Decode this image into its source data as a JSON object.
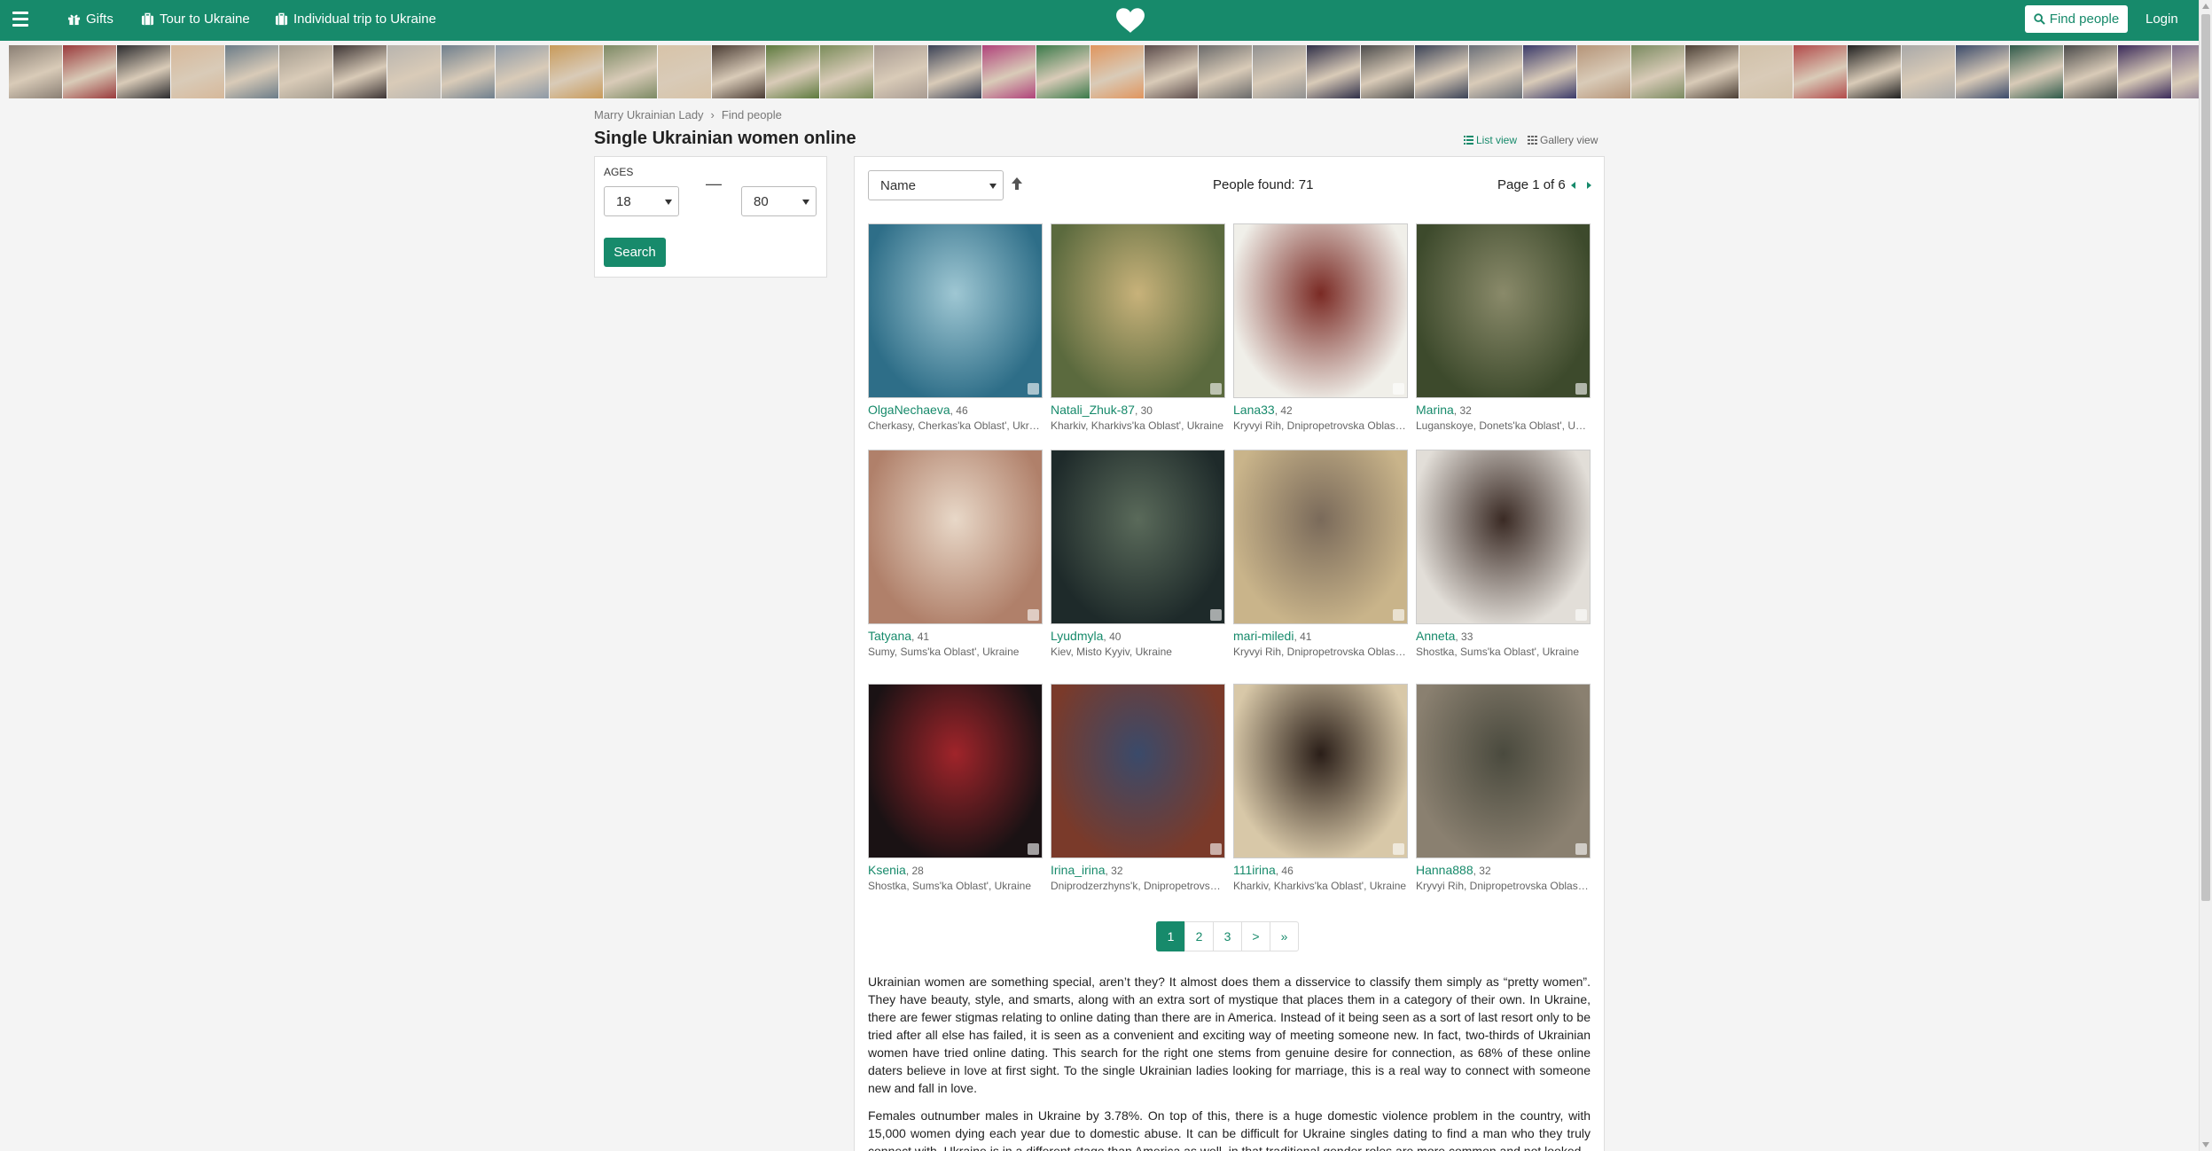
{
  "topbar": {
    "nav": [
      {
        "label": "Gifts",
        "icon": "gift-icon"
      },
      {
        "label": "Tour to Ukraine",
        "icon": "suitcase-icon"
      },
      {
        "label": "Individual trip to Ukraine",
        "icon": "suitcase-icon"
      }
    ],
    "find_label": "Find people",
    "login_label": "Login",
    "brand_color": "#178a6b"
  },
  "strip_colors": [
    "#8a7f74",
    "#9a3a3c",
    "#2b2b2e",
    "#d6b89a",
    "#6b7c88",
    "#a39b8e",
    "#3c3434",
    "#b8b4ae",
    "#6f7f8d",
    "#8d99a6",
    "#c89a5a",
    "#7c8a64",
    "#d7c3a8",
    "#4a3c34",
    "#5d7a3e",
    "#7a8c5a",
    "#a89b92",
    "#3b4256",
    "#b0427a",
    "#3a7a4a",
    "#e0955e",
    "#5a4a4a",
    "#6a6a6a",
    "#909090",
    "#2f2f48",
    "#4c4c4c",
    "#3a4256",
    "#6a6f78",
    "#3a3a6a",
    "#b59478",
    "#7a8a60",
    "#4c4036",
    "#d0c0a8",
    "#b24a4a",
    "#1f1f1f",
    "#a8a8a8",
    "#3a4a6a",
    "#2f5a4a",
    "#4a4a4a",
    "#3a2a5a",
    "#7c6a8a"
  ],
  "breadcrumb": {
    "home": "Marry Ukrainian Lady",
    "current": "Find people"
  },
  "page_title": "Single Ukrainian women online",
  "views": {
    "list": "List view",
    "gallery": "Gallery view"
  },
  "filter": {
    "ages_label": "AGES",
    "age_from": "18",
    "age_to": "80",
    "search_label": "Search"
  },
  "results": {
    "sort_value": "Name",
    "found_text": "People found: 71",
    "page_text": "Page 1 of 6"
  },
  "profiles": [
    {
      "name": "OlgaNechaeva",
      "age": ", 46",
      "loc": "Cherkasy, Cherkas'ka Oblast', Ukraine",
      "c1": "#2e6e88",
      "c2": "#9fc7d3"
    },
    {
      "name": "Natali_Zhuk-87",
      "age": ", 30",
      "loc": "Kharkiv, Kharkivs'ka Oblast', Ukraine",
      "c1": "#5b6a3e",
      "c2": "#c8b27a"
    },
    {
      "name": "Lana33",
      "age": ", 42",
      "loc": "Kryvyi Rih, Dnipropetrovska Oblast', Ukraine",
      "c1": "#f0efe9",
      "c2": "#7a2a24"
    },
    {
      "name": "Marina",
      "age": ", 32",
      "loc": "Luganskoye, Donets'ka Oblast', Ukraine",
      "c1": "#3d4a2c",
      "c2": "#8a8a6a"
    },
    {
      "name": "Tatyana",
      "age": ", 41",
      "loc": "Sumy, Sums'ka Oblast', Ukraine",
      "c1": "#b0806a",
      "c2": "#e8d8c8"
    },
    {
      "name": "Lyudmyla",
      "age": ", 40",
      "loc": "Kiev, Misto Kyyiv, Ukraine",
      "c1": "#1e2a2a",
      "c2": "#5a6a5a"
    },
    {
      "name": "mari-miledi",
      "age": ", 41",
      "loc": "Kryvyi Rih, Dnipropetrovska Oblast', Ukraine",
      "c1": "#c9b48a",
      "c2": "#7a6a5a"
    },
    {
      "name": "Anneta",
      "age": ", 33",
      "loc": "Shostka, Sums'ka Oblast', Ukraine",
      "c1": "#e2ded8",
      "c2": "#3a2a24"
    },
    {
      "name": "Ksenia",
      "age": ", 28",
      "loc": "Shostka, Sums'ka Oblast', Ukraine",
      "c1": "#1a1214",
      "c2": "#a0242a"
    },
    {
      "name": "Irina_irina",
      "age": ", 32",
      "loc": "Dniprodzerzhyns'k, Dnipropetrovska Oblast', Ukraine",
      "c1": "#7a3a2a",
      "c2": "#3a4a6a"
    },
    {
      "name": "111irina",
      "age": ", 46",
      "loc": "Kharkiv, Kharkivs'ka Oblast', Ukraine",
      "c1": "#d8c8a8",
      "c2": "#2a1e18"
    },
    {
      "name": "Hanna888",
      "age": ", 32",
      "loc": "Kryvyi Rih, Dnipropetrovska Oblast', Ukraine",
      "c1": "#8a8070",
      "c2": "#4a4a3e"
    }
  ],
  "pagination": [
    "1",
    "2",
    "3",
    ">",
    "»"
  ],
  "article": [
    "Ukrainian women are something special, aren’t they? It almost does them a disservice to classify them simply as “pretty women”. They have beauty, style, and smarts, along with an extra sort of mystique that places them in a category of their own. In Ukraine, there are fewer stigmas relating to online dating than there are in America. Instead of it being seen as a sort of last resort only to be tried after all else has failed, it is seen as a convenient and exciting way of meeting someone new. In fact, two-thirds of Ukrainian women have tried online dating. This search for the right one stems from genuine desire for connection, as 68% of these online daters believe in love at first sight. To the single Ukrainian ladies looking for marriage, this is a real way to connect with someone new and fall in love.",
    "Females outnumber males in Ukraine by 3.78%. On top of this, there is a huge domestic violence problem in the country, with 15,000 women dying each year due to domestic abuse. It can be difficult for Ukraine singles dating to find a man who they truly connect with. Ukraine is in a different stage than America as well, in that traditional gender roles are more common and not looked"
  ]
}
